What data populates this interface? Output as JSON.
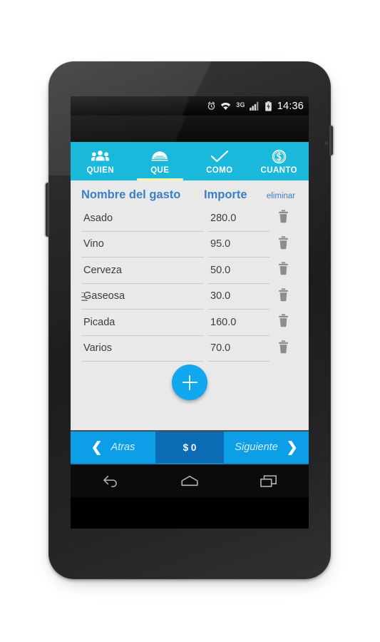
{
  "device": {
    "name": "android-phone",
    "statusbar": {
      "time": "14:36",
      "network": "3G",
      "icons": [
        "alarm-icon",
        "wifi-icon",
        "signal-icon",
        "battery-icon"
      ]
    },
    "navbar": {
      "back_label": "back-icon",
      "home_label": "home-icon",
      "recents_label": "recents-icon"
    }
  },
  "tabs": [
    {
      "label": "QUIEN",
      "icon": "people-group-icon",
      "active": false
    },
    {
      "label": "QUE",
      "icon": "food-dome-icon",
      "active": true
    },
    {
      "label": "COMO",
      "icon": "check-icon",
      "active": false
    },
    {
      "label": "CUANTO",
      "icon": "coin-dollar-icon",
      "active": false
    }
  ],
  "table": {
    "headers": {
      "name": "Nombre del gasto",
      "amount": "Importe",
      "delete": "eliminar"
    },
    "rows": [
      {
        "name": "Asado",
        "amount": "280.0",
        "handle": false
      },
      {
        "name": "Vino",
        "amount": "95.0",
        "handle": false
      },
      {
        "name": "Cerveza",
        "amount": "50.0",
        "handle": false
      },
      {
        "name": "Gaseosa",
        "amount": "30.0",
        "handle": true
      },
      {
        "name": "Picada",
        "amount": "160.0",
        "handle": false
      },
      {
        "name": "Varios",
        "amount": "70.0",
        "handle": false
      }
    ]
  },
  "fab": {
    "label": "+",
    "name": "add-expense-fab"
  },
  "bottom_bar": {
    "back_label": "Atras",
    "total_label": "$ 0",
    "next_label": "Siguiente"
  },
  "colors": {
    "tab_bar": "#1ab8da",
    "tab_indicator": "#f2f5a8",
    "header_text": "#3b7fc4",
    "fab": "#12a8ef",
    "button": "#0d9ee8",
    "button_dark": "#0b6bb5",
    "content_bg": "#e9e9e9"
  }
}
